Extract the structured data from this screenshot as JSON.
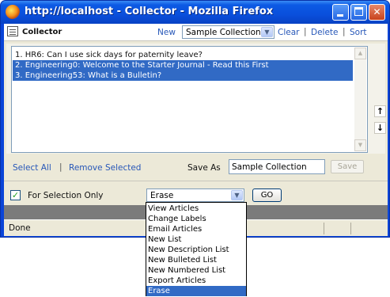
{
  "window": {
    "title": "http://localhost - Collector - Mozilla Firefox",
    "status": "Done"
  },
  "toolbar": {
    "title": "Collector",
    "new_label": "New",
    "collection_selected": "Sample Collection",
    "clear_label": "Clear",
    "delete_label": "Delete",
    "sort_label": "Sort"
  },
  "list": {
    "items": [
      {
        "label": "1. HR6: Can I use sick days for paternity leave?",
        "selected": false
      },
      {
        "label": "2. Engineering0: Welcome to the Starter Journal - Read this First",
        "selected": true
      },
      {
        "label": "3. Engineering53: What is a Bulletin?",
        "selected": true
      }
    ]
  },
  "actions": {
    "select_all": "Select All",
    "remove_selected": "Remove Selected",
    "save_as_label": "Save As",
    "save_as_value": "Sample Collection",
    "save_button": "Save"
  },
  "selection": {
    "checkbox_checked": true,
    "label": "For Selection Only",
    "action_selected": "Erase",
    "go_label": "GO",
    "options": [
      "View Articles",
      "Change Labels",
      "Email Articles",
      "New List",
      "New Description List",
      "New Bulleted List",
      "New Numbered List",
      "Export Articles",
      "Erase"
    ],
    "highlighted_option": "Erase"
  },
  "icons": {
    "window": "firefox-icon",
    "toolbar": "collector-icon",
    "move_up": "arrow-up-icon",
    "move_down": "arrow-down-icon"
  },
  "colors": {
    "titlebar": "#0a4fdc",
    "selection": "#316ac5",
    "link": "#2757b8"
  }
}
